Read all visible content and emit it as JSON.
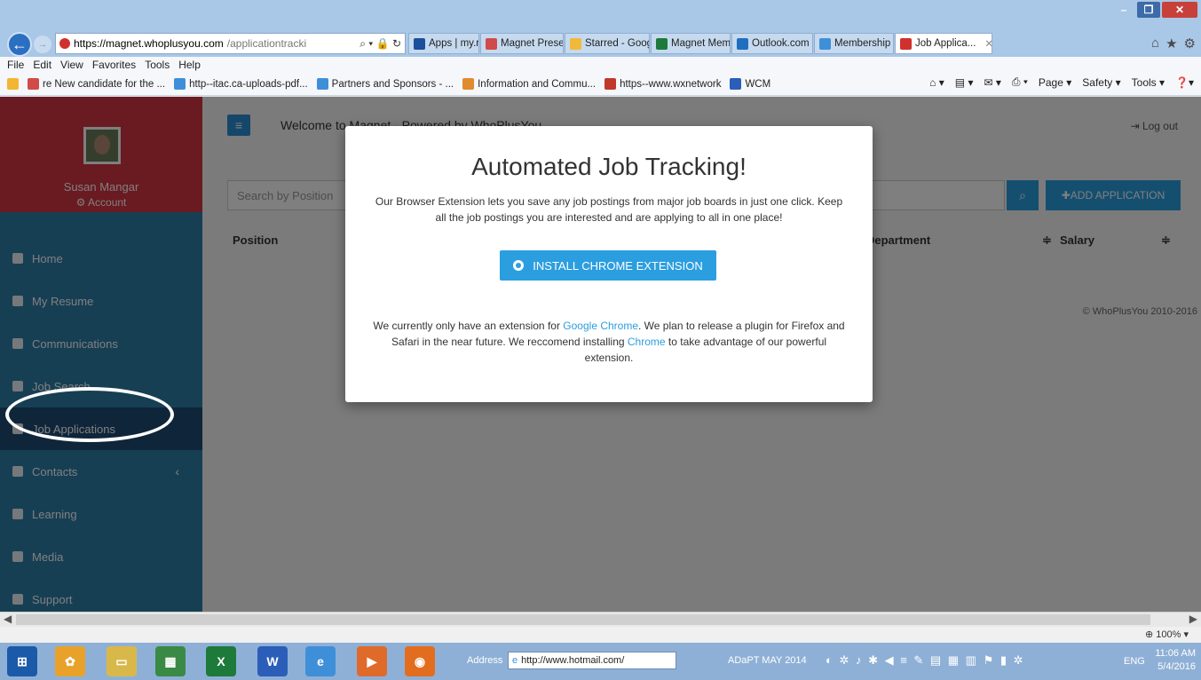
{
  "browser": {
    "url_main": "https://magnet.whoplusyou.com",
    "url_rest": "/applicationtracki",
    "tabs": [
      {
        "label": "Apps | my.ryer...",
        "color": "#1c4f9c"
      },
      {
        "label": "Magnet Presen...",
        "color": "#d14b4b"
      },
      {
        "label": "Starred - Googl...",
        "color": "#f1b93a"
      },
      {
        "label": "Magnet Memb...",
        "color": "#1d7a3a"
      },
      {
        "label": "Outlook.com -...",
        "color": "#1f6fc0"
      },
      {
        "label": "Membership D...",
        "color": "#3f8fd8"
      },
      {
        "label": "Job Applica...",
        "color": "#d0312d"
      }
    ],
    "menu": [
      "File",
      "Edit",
      "View",
      "Favorites",
      "Tools",
      "Help"
    ],
    "favorites": [
      "re New candidate for the ...",
      "http--itac.ca-uploads-pdf...",
      "Partners and Sponsors - ...",
      "Information and Commu...",
      "https--www.wxnetwork",
      "WCM"
    ],
    "commands": [
      "Page ▾",
      "Safety ▾",
      "Tools ▾"
    ],
    "zoom": "100%"
  },
  "app": {
    "welcome": "Welcome to Magnet - Powered by WhoPlusYou",
    "logout": "Log out",
    "user_name": "Susan Mangar",
    "account": "Account",
    "search_placeholder": "Search by Position",
    "add_button": "ADD APPLICATION",
    "columns": {
      "position": "Position",
      "department": "Department",
      "salary": "Salary"
    },
    "copyright": "© WhoPlusYou 2010-2016",
    "nav": [
      {
        "label": "Home"
      },
      {
        "label": "My Resume"
      },
      {
        "label": "Communications"
      },
      {
        "label": "Job Search"
      },
      {
        "label": "Job Applications"
      },
      {
        "label": "Contacts"
      },
      {
        "label": "Learning"
      },
      {
        "label": "Media"
      },
      {
        "label": "Support"
      }
    ]
  },
  "modal": {
    "title": "Automated Job Tracking!",
    "text": "Our Browser Extension lets you save any job postings from major job boards in just one click. Keep all the job postings you are interested and are applying to all in one place!",
    "button": "INSTALL CHROME EXTENSION",
    "foot_1": "We currently only have an extension for",
    "foot_link_1": "Google Chrome",
    "foot_2": ". We plan to release a plugin for Firefox and Safari in the near future. We reccomend installing",
    "foot_link_2": "Chrome",
    "foot_3": "to take advantage of our powerful extension."
  },
  "taskbar": {
    "address_label": "Address",
    "address": "http://www.hotmail.com/",
    "adapt": "ADaPT MAY 2014",
    "lang": "ENG",
    "time": "11:06 AM",
    "date": "5/4/2016"
  },
  "colors": {
    "accent": "#2b9ee0",
    "sidebar": "#2f7fa8",
    "profile": "#d43542"
  }
}
